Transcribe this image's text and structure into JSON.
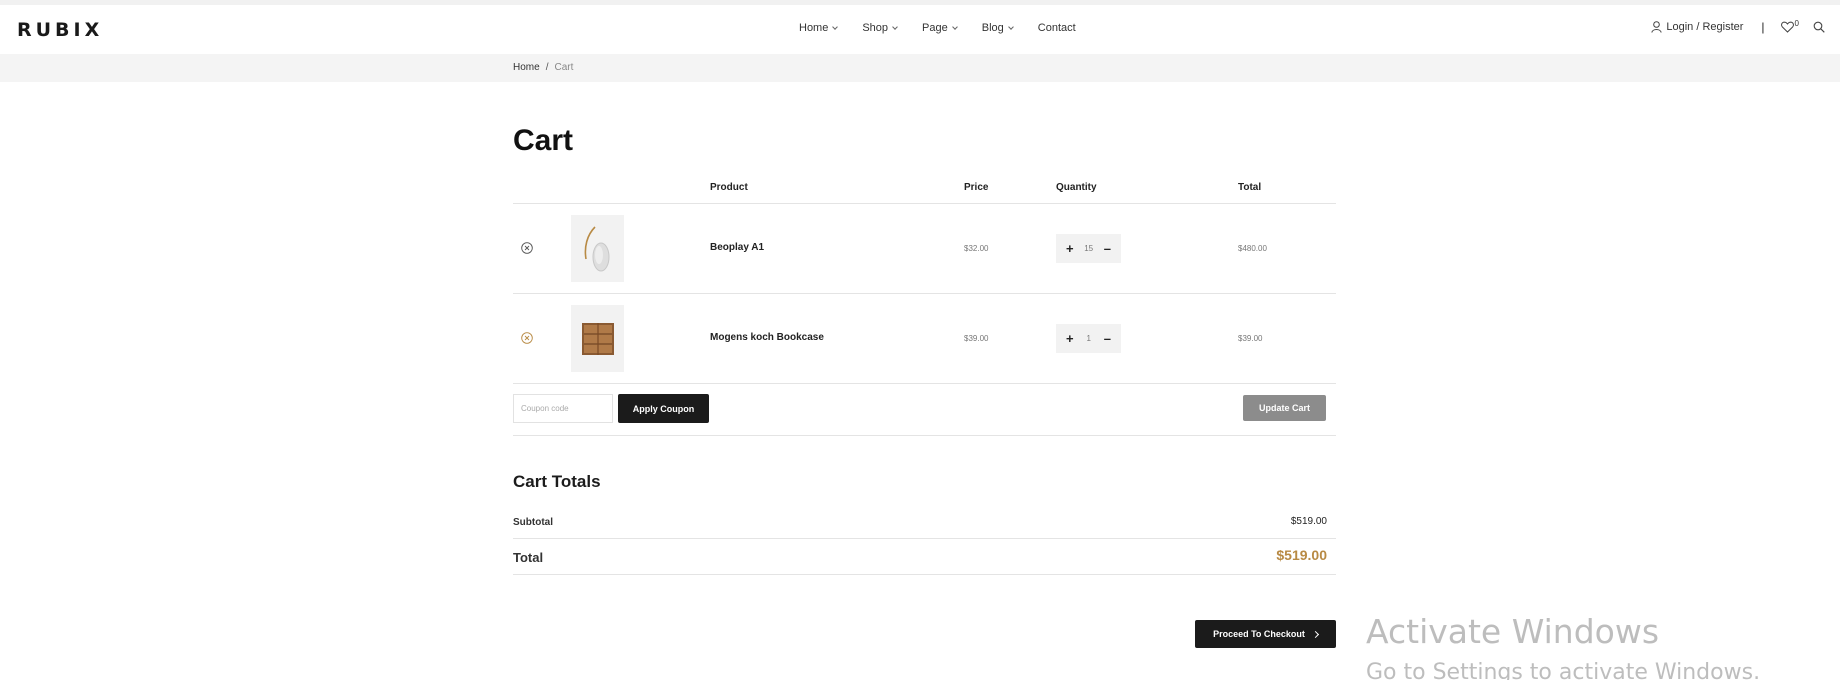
{
  "brand": {
    "logo": "RUBIX"
  },
  "nav": {
    "items": [
      "Home",
      "Shop",
      "Page",
      "Blog",
      "Contact"
    ]
  },
  "header": {
    "login_label": "Login / Register",
    "separator": "|",
    "wishlist_count": "0"
  },
  "breadcrumb": {
    "home": "Home",
    "separator": "/",
    "current": "Cart"
  },
  "page": {
    "title": "Cart"
  },
  "table": {
    "headers": {
      "product": "Product",
      "price": "Price",
      "quantity": "Quantity",
      "total": "Total"
    },
    "rows": [
      {
        "name": "Beoplay A1",
        "price": "$32.00",
        "qty": "15",
        "total": "$480.00"
      },
      {
        "name": "Mogens koch Bookcase",
        "price": "$39.00",
        "qty": "1",
        "total": "$39.00"
      }
    ],
    "qty_plus": "+",
    "qty_minus": "–"
  },
  "actions": {
    "coupon_placeholder": "Coupon code",
    "apply_label": "Apply Coupon",
    "update_label": "Update Cart"
  },
  "totals": {
    "title": "Cart Totals",
    "subtotal_label": "Subtotal",
    "subtotal_value": "$519.00",
    "total_label": "Total",
    "total_value": "$519.00"
  },
  "checkout": {
    "label": "Proceed To Checkout"
  },
  "watermark": {
    "title": "Activate Windows",
    "subtitle": "Go to Settings to activate Windows."
  },
  "colors": {
    "accent": "#b88a44",
    "dark": "#1b1b1b",
    "muted_button": "#8c8c8c"
  }
}
